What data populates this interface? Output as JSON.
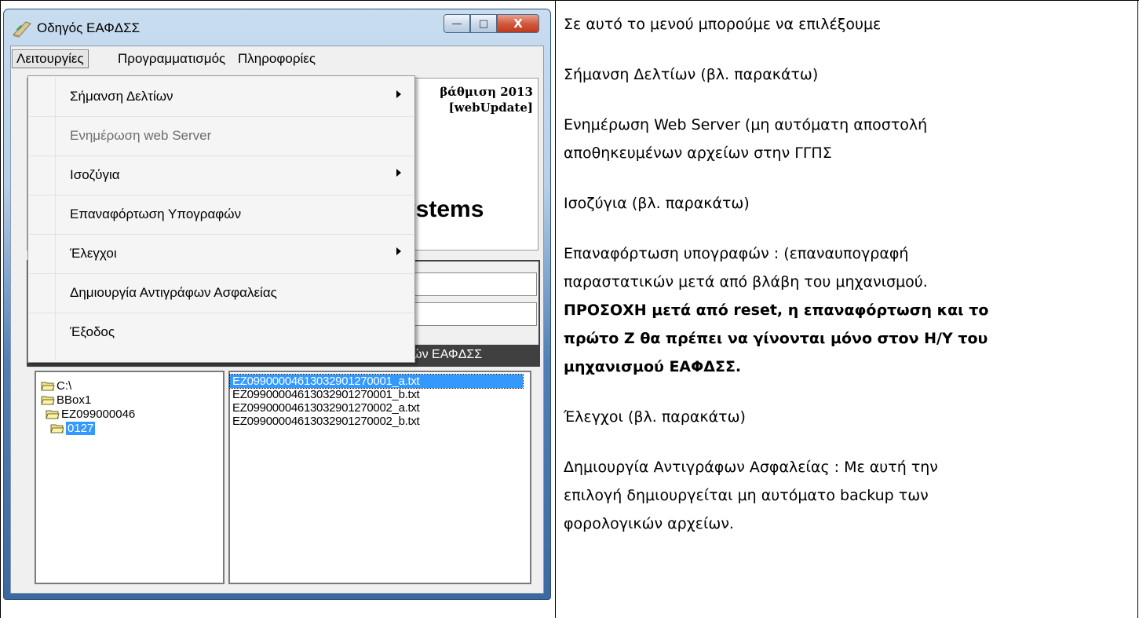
{
  "window": {
    "title": "Οδηγός ΕΑΦΔΣΣ",
    "caption_buttons": {
      "minimize": "—",
      "maximize": "□",
      "close": "X"
    }
  },
  "menubar": {
    "items": [
      "Λειτουργίες",
      "Προγραμματισμός",
      "Πληροφορίες"
    ]
  },
  "dropdown": {
    "items": [
      {
        "label": "Σήμανση Δελτίων",
        "submenu": true,
        "disabled": false
      },
      {
        "label": "Ενημέρωση web Server",
        "submenu": false,
        "disabled": true
      },
      {
        "label": "Ισοζύγια",
        "submenu": true,
        "disabled": false
      },
      {
        "label": "Επαναφόρτωση Υπογραφών",
        "submenu": false,
        "disabled": false
      },
      {
        "label": "Έλεγχοι",
        "submenu": true,
        "disabled": false
      },
      {
        "label": "Δημιουργία Αντιγράφων Ασφαλείας",
        "submenu": false,
        "disabled": false
      },
      {
        "label": "Έξοδος",
        "submenu": false,
        "disabled": false
      }
    ]
  },
  "info": {
    "line1": "βάθμιση 2013",
    "line2": "[webUpdate]",
    "glyph": "/",
    "dash": "_",
    "systems": "ystems"
  },
  "darkbar_text": "ρών ΕΑΦΔΣΣ",
  "tree": {
    "items": [
      {
        "label": "C:\\",
        "selected": false
      },
      {
        "label": "BBox1",
        "selected": false
      },
      {
        "label": "EZ099000046",
        "selected": false
      },
      {
        "label": "0127",
        "selected": true
      }
    ]
  },
  "files": {
    "items": [
      {
        "label": "EZ09900004613032901270001_a.txt",
        "selected": true
      },
      {
        "label": "EZ09900004613032901270001_b.txt",
        "selected": false
      },
      {
        "label": "EZ09900004613032901270002_a.txt",
        "selected": false
      },
      {
        "label": "EZ09900004613032901270002_b.txt",
        "selected": false
      }
    ]
  },
  "right_text": {
    "p1": "Σε αυτό το μενού μπορούμε να επιλέξουμε",
    "p2": "Σήμανση Δελτίων (βλ. παρακάτω)",
    "p3a": "Ενημέρωση Web Server (μη αυτόματη αποστολή",
    "p3b": "αποθηκευμένων αρχείων στην ΓΓΠΣ",
    "p4": "Ισοζύγια (βλ. παρακάτω)",
    "p5a": "Επαναφόρτωση υπογραφών : (επαναυπογραφή",
    "p5b": "παραστατικών μετά από βλάβη του μηχανισμού.",
    "p5c": "ΠΡΟΣΟΧΗ μετά από reset, η επαναφόρτωση και το",
    "p5d": "πρώτο Ζ θα πρέπει να γίνονται μόνο στον Η/Υ του",
    "p5e": "μηχανισμού ΕΑΦΔΣΣ.",
    "p6": "Έλεγχοι (βλ. παρακάτω)",
    "p7a": "Δημιουργία Αντιγράφων Ασφαλείας : Με αυτή την",
    "p7b": "επιλογή δημιουργείται μη αυτόματο backup των",
    "p7c": "φορολογικών αρχείων."
  },
  "colors": {
    "selection": "#3399ff",
    "close_button": "#c0391c",
    "darkbar": "#404040"
  }
}
